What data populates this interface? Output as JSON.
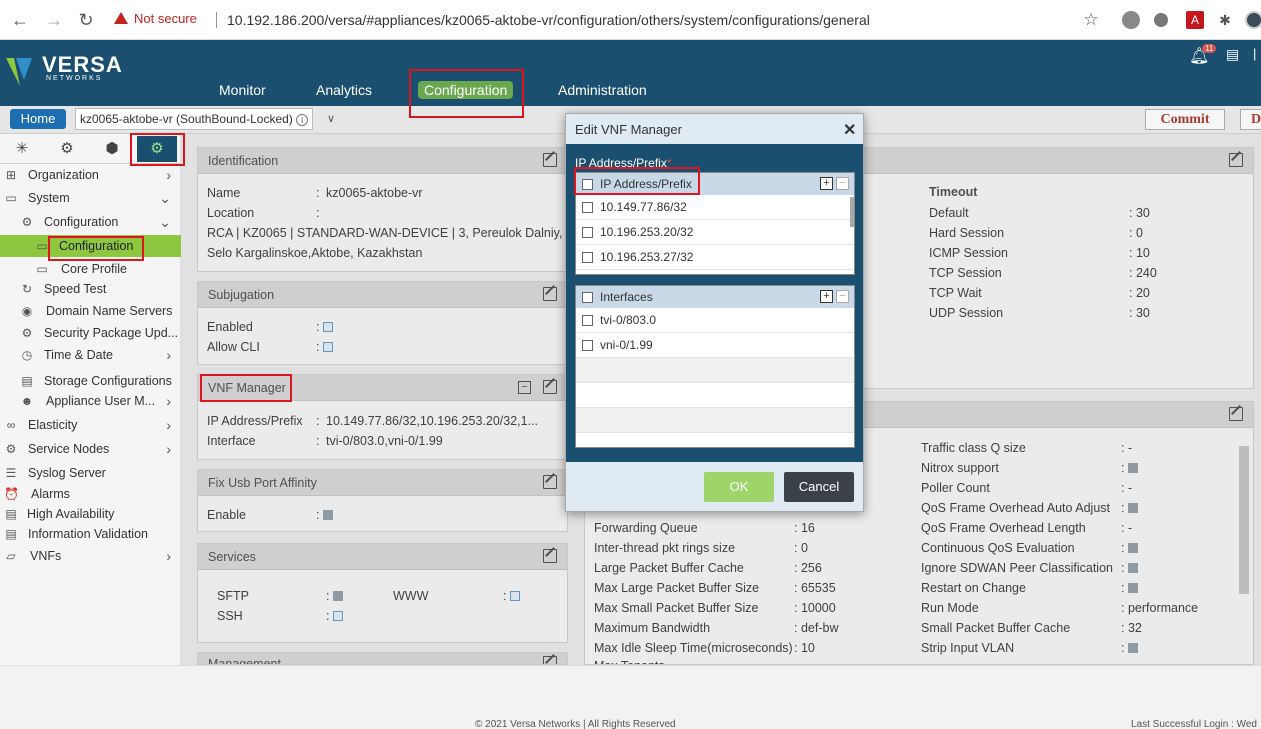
{
  "browser": {
    "not_secure": "Not secure",
    "url": "10.192.186.200/versa/#appliances/kz0065-aktobe-vr/configuration/others/system/configurations/general"
  },
  "header": {
    "logo_main": "VERSA",
    "logo_sub": "NETWORKS",
    "nav": [
      "Monitor",
      "Analytics",
      "Configuration",
      "Administration"
    ],
    "notif_count": "11"
  },
  "subbar": {
    "home": "Home",
    "appliance": "kz0065-aktobe-vr (SouthBound-Locked)",
    "commit": "Commit",
    "d": "D"
  },
  "sidebar": {
    "items": [
      {
        "label": "Organization"
      },
      {
        "label": "System"
      },
      {
        "label": "Configuration"
      },
      {
        "label": "Configuration"
      },
      {
        "label": "Core Profile"
      },
      {
        "label": "Speed Test"
      },
      {
        "label": "Domain Name Servers"
      },
      {
        "label": "Security Package Upd..."
      },
      {
        "label": "Time & Date"
      },
      {
        "label": "Storage Configurations"
      },
      {
        "label": "Appliance User M..."
      },
      {
        "label": "Elasticity"
      },
      {
        "label": "Service Nodes"
      },
      {
        "label": "Syslog Server"
      },
      {
        "label": "Alarms"
      },
      {
        "label": "High Availability"
      },
      {
        "label": "Information Validation"
      },
      {
        "label": "VNFs"
      }
    ]
  },
  "identification": {
    "title": "Identification",
    "name_label": "Name",
    "name_value": "kz0065-aktobe-vr",
    "location_label": "Location",
    "location_line1": "RCA | KZ0065 | STANDARD-WAN-DEVICE | 3, Pereulok Dalniy,",
    "location_line2": "Selo Kargalinskoe,Aktobe, Kazakhstan"
  },
  "subjugation": {
    "title": "Subjugation",
    "enabled_label": "Enabled",
    "allow_cli_label": "Allow CLI"
  },
  "vnf_manager": {
    "title": "VNF Manager",
    "ip_label": "IP Address/Prefix",
    "ip_value": "10.149.77.86/32,10.196.253.20/32,1...",
    "iface_label": "Interface",
    "iface_value": "tvi-0/803.0,vni-0/1.99"
  },
  "fix_usb": {
    "title": "Fix Usb Port Affinity",
    "enable_label": "Enable"
  },
  "services": {
    "title": "Services",
    "sftp": "SFTP",
    "www": "WWW",
    "ssh": "SSH"
  },
  "management": {
    "title": "Management"
  },
  "timeout": {
    "title": "Timeout",
    "rows": [
      {
        "label": "Default",
        "value": "30"
      },
      {
        "label": "Hard Session",
        "value": "0"
      },
      {
        "label": "ICMP Session",
        "value": "10"
      },
      {
        "label": "TCP Session",
        "value": "240"
      },
      {
        "label": "TCP Wait",
        "value": "20"
      },
      {
        "label": "UDP Session",
        "value": "30"
      }
    ]
  },
  "perf_left": [
    {
      "label": "Forwarding Queue",
      "value": "16"
    },
    {
      "label": "Inter-thread pkt rings size",
      "value": "0"
    },
    {
      "label": "Large Packet Buffer Cache",
      "value": "256"
    },
    {
      "label": "Max Large Packet Buffer Size",
      "value": "65535"
    },
    {
      "label": "Max Small Packet Buffer Size",
      "value": "10000"
    },
    {
      "label": "Maximum Bandwidth",
      "value": "def-bw"
    },
    {
      "label": "Max Idle Sleep Time(microseconds)",
      "value": "10"
    }
  ],
  "perf_right": [
    {
      "label": "Traffic class Q size",
      "value": "-",
      "cb": false
    },
    {
      "label": "Nitrox support",
      "value": "",
      "cb": true
    },
    {
      "label": "Poller Count",
      "value": "-",
      "cb": false
    },
    {
      "label": "QoS Frame Overhead Auto Adjust",
      "value": "",
      "cb": true
    },
    {
      "label": "QoS Frame Overhead Length",
      "value": "-",
      "cb": false
    },
    {
      "label": "Continuous QoS Evaluation",
      "value": "",
      "cb": true
    },
    {
      "label": "Ignore SDWAN Peer Classification",
      "value": "",
      "cb": true
    },
    {
      "label": "Restart on Change",
      "value": "",
      "cb": true
    },
    {
      "label": "Run Mode",
      "value": "performance",
      "cb": false
    },
    {
      "label": "Small Packet Buffer Cache",
      "value": "32",
      "cb": false
    },
    {
      "label": "Strip Input VLAN",
      "value": "",
      "cb": true
    }
  ],
  "modal": {
    "title": "Edit VNF Manager",
    "ip_label": "IP Address/Prefix",
    "ip_header": "IP Address/Prefix",
    "ips": [
      "10.149.77.86/32",
      "10.196.253.20/32",
      "10.196.253.27/32"
    ],
    "iface_header": "Interfaces",
    "ifaces": [
      "tvi-0/803.0",
      "vni-0/1.99"
    ],
    "ok": "OK",
    "cancel": "Cancel"
  },
  "footer": {
    "copyright": "© 2021 Versa Networks | All Rights Reserved",
    "last_login": "Last Successful Login : Wed"
  }
}
